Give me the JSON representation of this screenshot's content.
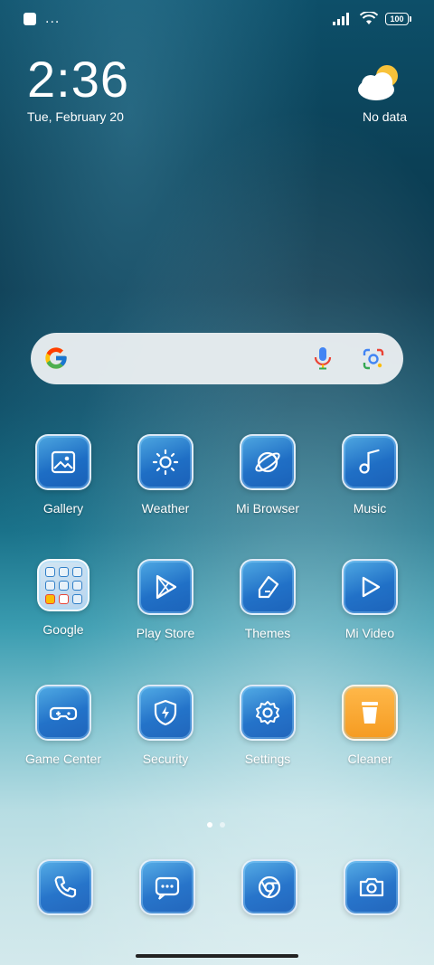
{
  "status_bar": {
    "dots": "...",
    "battery": "100"
  },
  "clock": {
    "time": "2:36",
    "date": "Tue, February 20"
  },
  "weather_widget": {
    "text": "No data",
    "icon": "partly-cloudy-icon"
  },
  "search": {
    "logo": "google-logo-icon",
    "mic_icon": "mic-icon",
    "lens_icon": "lens-icon"
  },
  "apps": [
    {
      "label": "Gallery",
      "icon": "gallery-icon"
    },
    {
      "label": "Weather",
      "icon": "sun-icon"
    },
    {
      "label": "Mi Browser",
      "icon": "planet-icon"
    },
    {
      "label": "Music",
      "icon": "music-note-icon"
    },
    {
      "label": "Google",
      "icon": "folder-icon"
    },
    {
      "label": "Play Store",
      "icon": "play-store-icon"
    },
    {
      "label": "Themes",
      "icon": "themes-brush-icon"
    },
    {
      "label": "Mi Video",
      "icon": "video-play-icon"
    },
    {
      "label": "Game Center",
      "icon": "gamepad-icon"
    },
    {
      "label": "Security",
      "icon": "shield-bolt-icon"
    },
    {
      "label": "Settings",
      "icon": "gear-icon"
    },
    {
      "label": "Cleaner",
      "icon": "trash-icon"
    }
  ],
  "dock": [
    {
      "icon": "phone-icon"
    },
    {
      "icon": "message-icon"
    },
    {
      "icon": "chrome-icon"
    },
    {
      "icon": "camera-icon"
    }
  ],
  "page_indicator": {
    "count": 2,
    "active": 1
  }
}
